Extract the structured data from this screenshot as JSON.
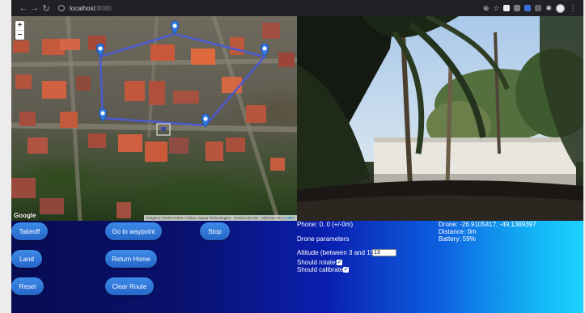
{
  "browser": {
    "nav": {
      "back_icon": "←",
      "forward_icon": "→",
      "reload_icon": "↻"
    },
    "url_host": "localhost",
    "url_port": ":8080"
  },
  "map": {
    "zoom_in": "+",
    "zoom_out": "−",
    "logo": "Google",
    "attribution": "Imagens ©2022 CNES / Airbus, Maxar Technologies · Termos de Uso · Informar erro",
    "leaflet": "Leaflet",
    "colors": {
      "route_line": "#4b5bd6",
      "marker": "#2f7be0"
    }
  },
  "buttons": {
    "takeoff": "Takeoff",
    "go_to_waypoint": "Go to waypoint",
    "stop": "Stop",
    "land": "Land",
    "return_home": "Return Home",
    "reset": "Reset",
    "clear_route": "Clear Route"
  },
  "status": {
    "phone": "Phone: 0, 0 (+/-0m)",
    "drone": "Drone: -26.9105417, -49.1389397",
    "distance": "Distance: 0m",
    "battery": "Battery: 59%"
  },
  "params": {
    "heading": "Drone parameters",
    "altitude_label": "Altitude (between 3 and 15):",
    "altitude_value": "13",
    "rotate_label": "Should rotate:",
    "rotate_checked": true,
    "calibrate_label": "Should calibrate:",
    "calibrate_checked": true
  },
  "colors": {
    "panel_left": "#080c52",
    "panel_right": "#1ed2ff",
    "button": "#2f7be0"
  }
}
